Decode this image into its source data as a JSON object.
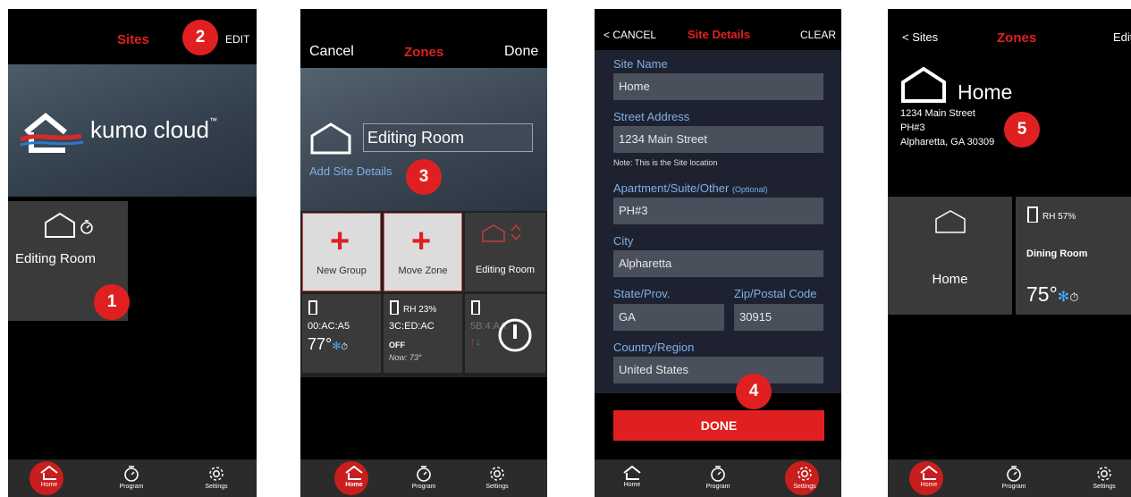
{
  "badges": {
    "b1": "1",
    "b2": "2",
    "b3": "3",
    "b4": "4",
    "b5": "5"
  },
  "tabs": {
    "home": "Home",
    "program": "Program",
    "settings": "Settings"
  },
  "screen1": {
    "title": "Sites",
    "edit": "EDIT",
    "logo_text": "kumo cloud",
    "logo_tm": "™",
    "site_name": "Editing Room"
  },
  "screen2": {
    "cancel": "Cancel",
    "title": "Zones",
    "done": "Done",
    "name_value": "Editing Room",
    "add_details": "Add Site Details",
    "tiles": {
      "new_group": "New Group",
      "move_zone": "Move Zone",
      "editing_room": "Editing Room"
    },
    "zones": [
      {
        "id": "00:AC:A5",
        "temp": "77°"
      },
      {
        "id": "3C:ED:AC",
        "rh": "RH 23%",
        "state": "OFF",
        "now": "Now: 73°"
      },
      {
        "id": "5B:4:AA"
      }
    ]
  },
  "screen3": {
    "cancel": "< CANCEL",
    "title": "Site Details",
    "clear": "CLEAR",
    "labels": {
      "site_name": "Site Name",
      "street": "Street Address",
      "note": "Note: This is the Site location",
      "apt": "Apartment/Suite/Other",
      "apt_optional": "(Optional)",
      "city": "City",
      "state": "State/Prov.",
      "zip": "Zip/Postal Code",
      "country": "Country/Region"
    },
    "values": {
      "site_name": "Home",
      "street": "1234 Main Street",
      "apt": "PH#3",
      "city": "Alpharetta",
      "state": "GA",
      "zip": "30915",
      "country": "United States"
    },
    "done": "DONE"
  },
  "screen4": {
    "back": "< Sites",
    "title": "Zones",
    "edit": "Edit",
    "home_title": "Home",
    "address_lines": [
      "1234 Main Street",
      "PH#3",
      "Alpharetta, GA 30309"
    ],
    "home_tile": "Home",
    "zone": {
      "rh": "RH 57%",
      "name": "Dining Room",
      "temp": "75°"
    }
  },
  "colors": {
    "accent": "#e02020",
    "field_label": "#7fb0e6",
    "field_bg": "#4a4f5c",
    "tile_bg": "#3a3a3a"
  }
}
